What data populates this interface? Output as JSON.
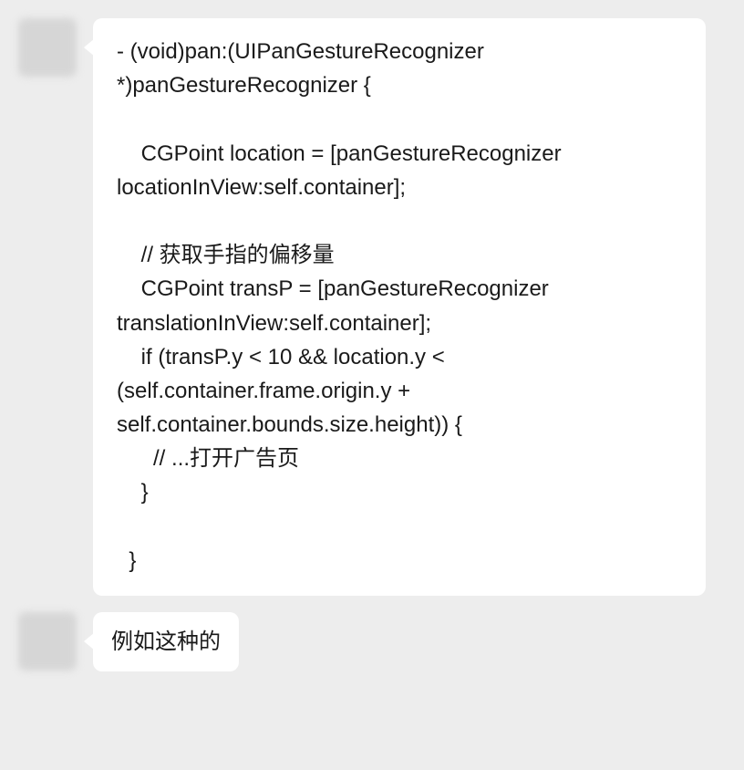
{
  "messages": [
    {
      "type": "code",
      "content": "- (void)pan:(UIPanGestureRecognizer *)panGestureRecognizer {\n\n    CGPoint location = [panGestureRecognizer locationInView:self.container];\n\n    // 获取手指的偏移量\n    CGPoint transP = [panGestureRecognizer translationInView:self.container];\n    if (transP.y < 10 && location.y < (self.container.frame.origin.y + self.container.bounds.size.height)) {\n      // ...打开广告页\n    }\n\n  }"
    },
    {
      "type": "text",
      "content": "例如这种的"
    }
  ]
}
